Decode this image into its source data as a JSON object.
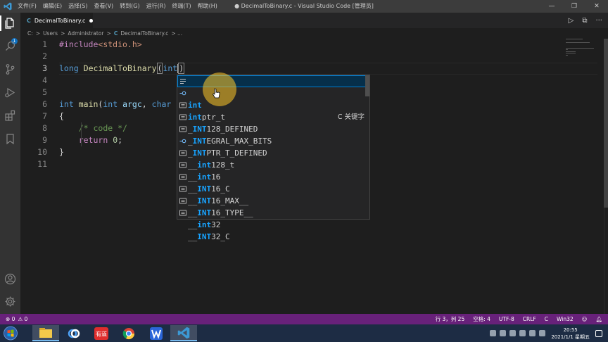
{
  "window": {
    "title": "● DecimalToBinary.c - Visual Studio Code [管理员]",
    "menu": [
      "文件(F)",
      "编辑(E)",
      "选择(S)",
      "查看(V)",
      "转到(G)",
      "运行(R)",
      "终端(T)",
      "帮助(H)"
    ],
    "controls": [
      "—",
      "❐",
      "✕"
    ]
  },
  "activity_bar": {
    "items": [
      "explorer-icon",
      "search-icon",
      "source-control-icon",
      "run-debug-icon",
      "extensions-icon",
      "bookmarks-icon"
    ],
    "badge": "1",
    "bottom": [
      "account-icon",
      "settings-gear-icon"
    ]
  },
  "tabs": [
    {
      "icon": "C",
      "label": "DecimalToBinary.c",
      "dirty": true
    }
  ],
  "editor_actions": [
    "▷",
    "⧉",
    "···"
  ],
  "breadcrumb": {
    "parts": [
      "C:",
      ">",
      "Users",
      ">",
      "Administrator",
      ">"
    ],
    "file_icon": "C",
    "file": "DecimalToBinary.c",
    "tail": "> ..."
  },
  "editor": {
    "line_numbers": [
      "1",
      "2",
      "3",
      "4",
      "5",
      "6",
      "7",
      "8",
      "9",
      "10",
      "11"
    ],
    "lines": {
      "l1": {
        "directive": "#include",
        "header": "<stdio.h>"
      },
      "l3": {
        "type": "long",
        "name": "DecimalToBinary",
        "open": "(",
        "param": "int",
        "close": ")"
      },
      "l6": {
        "type": "int",
        "name": "main",
        "open": "(",
        "p1type": "int",
        "p1": "argc",
        "comma": ",",
        "p2type": "char"
      },
      "l7": {
        "text": "{"
      },
      "l8": {
        "comment": "/* code */"
      },
      "l9": {
        "kw": "return",
        "num": "0",
        "semi": ";"
      },
      "l10": {
        "text": "}"
      }
    }
  },
  "suggest": {
    "items": [
      {
        "match": "int",
        "rest": "",
        "kind": "keyword",
        "detail": "C 关键字"
      },
      {
        "match": "int",
        "rest": "ptr_t",
        "kind": "struct"
      },
      {
        "pre": "_",
        "match": "INT",
        "rest": "128_DEFINED",
        "kind": "constant"
      },
      {
        "pre": "_",
        "match": "INT",
        "rest": "EGRAL_MAX_BITS",
        "kind": "constant"
      },
      {
        "pre": "_",
        "match": "INT",
        "rest": "PTR_T_DEFINED",
        "kind": "constant"
      },
      {
        "pre": "__",
        "match": "int",
        "rest": "128_t",
        "kind": "struct"
      },
      {
        "pre": "__",
        "match": "int",
        "rest": "16",
        "kind": "constant"
      },
      {
        "pre": "__",
        "match": "INT",
        "rest": "16_C",
        "kind": "constant"
      },
      {
        "pre": "__",
        "match": "INT",
        "rest": "16_MAX__",
        "kind": "constant"
      },
      {
        "pre": "__",
        "match": "INT",
        "rest": "16_TYPE__",
        "kind": "constant"
      },
      {
        "pre": "__",
        "match": "int",
        "rest": "32",
        "kind": "constant"
      },
      {
        "pre": "__",
        "match": "INT",
        "rest": "32_C",
        "kind": "constant"
      }
    ]
  },
  "status_bar": {
    "errors": "⊗ 0",
    "warnings": "⚠ 0",
    "position": "行 3，列 25",
    "spaces": "空格: 4",
    "encoding": "UTF-8",
    "eol": "CRLF",
    "language": "C",
    "platform": "Win32",
    "color": "#68217a"
  },
  "taskbar": {
    "apps": [
      "file-explorer-icon",
      "baidu-netdisk-icon",
      "youdao-dict-icon",
      "chrome-icon",
      "wps-icon",
      "vscode-icon"
    ],
    "youdao_label": "有道",
    "time": "20:55",
    "date": "2021/1/1 星期五"
  }
}
